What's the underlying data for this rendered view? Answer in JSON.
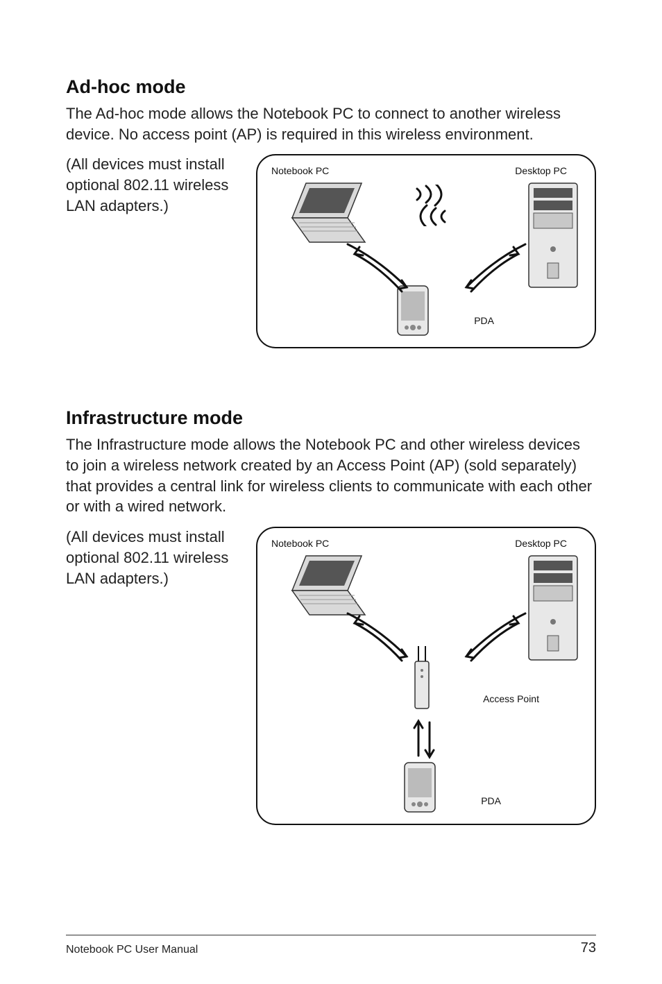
{
  "sections": {
    "adhoc": {
      "title": "Ad-hoc mode",
      "body": "The Ad-hoc mode allows the Notebook PC to connect to another wireless device. No access point (AP) is required in this wireless environment.",
      "note": "(All devices must install optional 802.11 wireless LAN adapters.)",
      "labels": {
        "notebook": "Notebook PC",
        "desktop": "Desktop PC",
        "pda": "PDA"
      }
    },
    "infra": {
      "title": "Infrastructure mode",
      "body": "The Infrastructure mode allows the Notebook PC and other wireless devices to join a wireless network created by an Access Point (AP) (sold separately) that provides a central link for wireless clients to communicate with each other or with a wired network.",
      "note": "(All devices must install optional 802.11 wireless LAN adapters.)",
      "labels": {
        "notebook": "Notebook PC",
        "desktop": "Desktop PC",
        "accesspoint": "Access Point",
        "pda": "PDA"
      }
    }
  },
  "footer": {
    "left": "Notebook PC User Manual",
    "page": "73"
  }
}
